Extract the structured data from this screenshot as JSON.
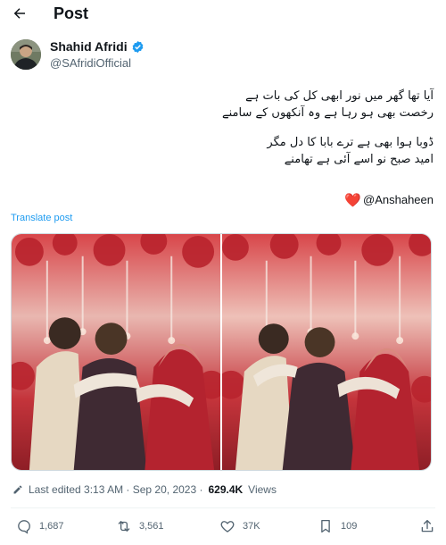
{
  "header": {
    "title": "Post",
    "back_icon": "arrow-left-icon"
  },
  "author": {
    "name": "Shahid Afridi",
    "handle": "@SAfridiOfficial",
    "verified": true,
    "verified_color": "#1d9bf0"
  },
  "post": {
    "lines": [
      "آیا تھا گھر میں نور ابھی کل کی بات ہے",
      "رخصت بھی ہو رہا ہے  وہ آنکھوں کے سامنے",
      "ڈوبا ہوا بھی ہے ترے بابا کا دل مگر",
      "امید صبح نو اسے آئی ہے تھامنے"
    ],
    "mention": "@Anshaheen",
    "heart": "❤️",
    "translate_label": "Translate post"
  },
  "meta": {
    "edited_text": "Last edited 3:13 AM · Sep 20, 2023 ·",
    "views_count": "629.4K",
    "views_label": "Views"
  },
  "actions": {
    "replies": "1,687",
    "reposts": "3,561",
    "likes": "37K",
    "bookmarks": "109"
  },
  "colors": {
    "accent": "#1d9bf0",
    "text": "#0f1419",
    "muted": "#536471",
    "heart": "#d8202a"
  }
}
